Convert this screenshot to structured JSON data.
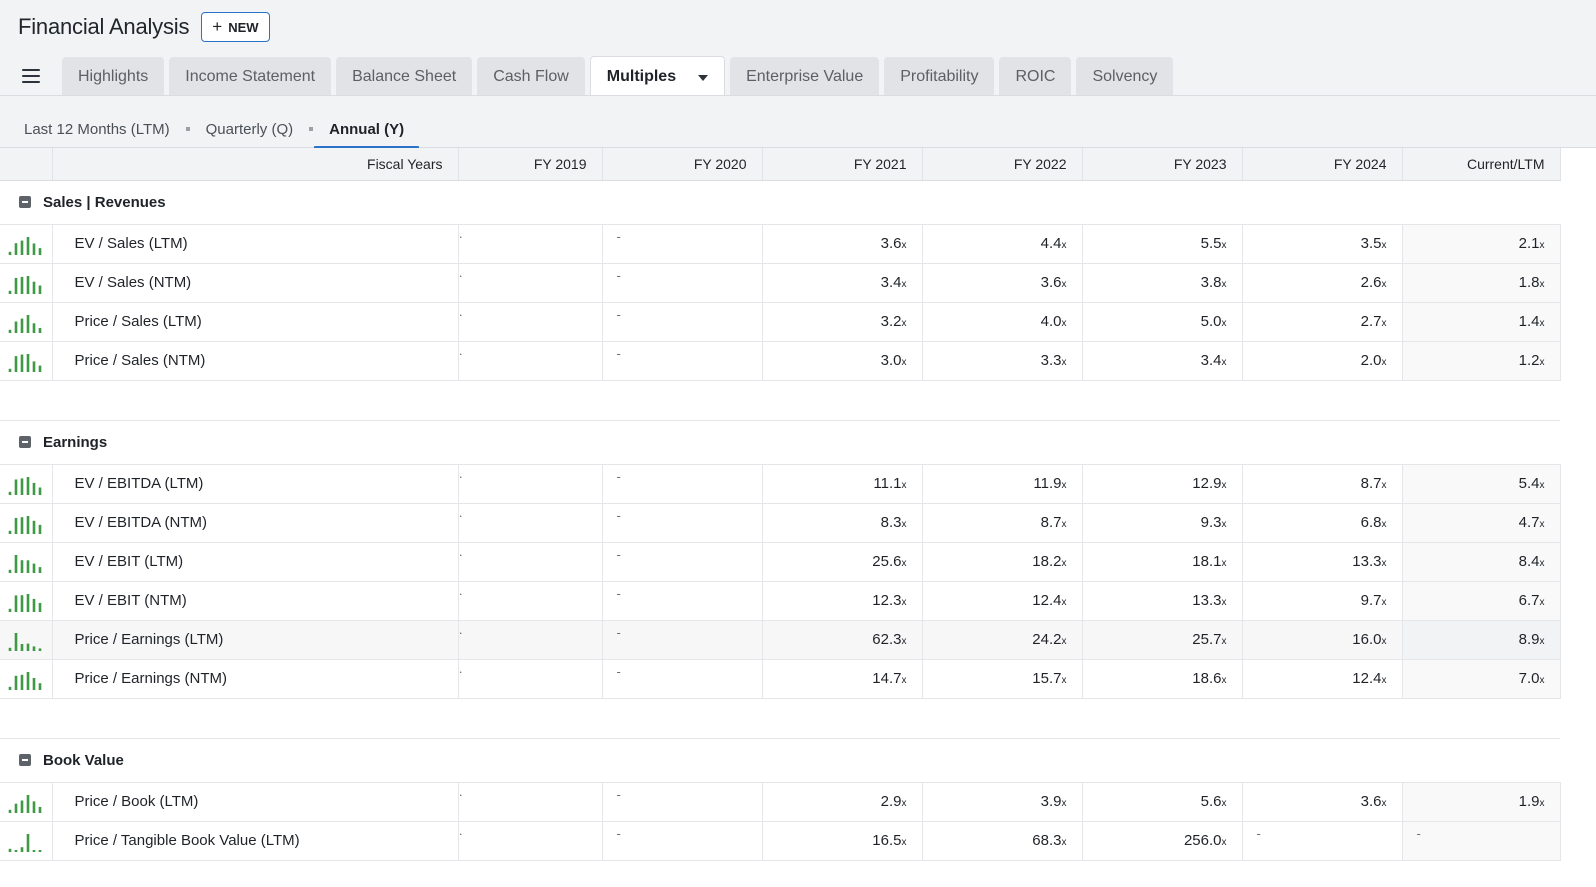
{
  "header": {
    "title": "Financial Analysis",
    "new_label": "NEW"
  },
  "tabs": [
    {
      "label": "Highlights",
      "active": false
    },
    {
      "label": "Income Statement",
      "active": false
    },
    {
      "label": "Balance Sheet",
      "active": false
    },
    {
      "label": "Cash Flow",
      "active": false
    },
    {
      "label": "Multiples",
      "active": true
    },
    {
      "label": "Enterprise Value",
      "active": false
    },
    {
      "label": "Profitability",
      "active": false
    },
    {
      "label": "ROIC",
      "active": false
    },
    {
      "label": "Solvency",
      "active": false
    }
  ],
  "periods": [
    {
      "label": "Last 12 Months (LTM)",
      "active": false
    },
    {
      "label": "Quarterly (Q)",
      "active": false
    },
    {
      "label": "Annual (Y)",
      "active": true
    }
  ],
  "table": {
    "columns": [
      "Fiscal Years",
      "FY 2019",
      "FY 2020",
      "FY 2021",
      "FY 2022",
      "FY 2023",
      "FY 2024",
      "Current/LTM"
    ],
    "empty_marker": "-",
    "unit_suffix": "x",
    "sections": [
      {
        "title": "Sales | Revenues",
        "rows": [
          {
            "label": "EV / Sales (LTM)",
            "values": [
              "3.6",
              "4.4",
              "5.5",
              "3.5",
              "2.1"
            ]
          },
          {
            "label": "EV / Sales (NTM)",
            "values": [
              "3.4",
              "3.6",
              "3.8",
              "2.6",
              "1.8"
            ]
          },
          {
            "label": "Price / Sales (LTM)",
            "values": [
              "3.2",
              "4.0",
              "5.0",
              "2.7",
              "1.4"
            ]
          },
          {
            "label": "Price / Sales (NTM)",
            "values": [
              "3.0",
              "3.3",
              "3.4",
              "2.0",
              "1.2"
            ]
          }
        ]
      },
      {
        "title": "Earnings",
        "rows": [
          {
            "label": "EV / EBITDA (LTM)",
            "values": [
              "11.1",
              "11.9",
              "12.9",
              "8.7",
              "5.4"
            ]
          },
          {
            "label": "EV / EBITDA (NTM)",
            "values": [
              "8.3",
              "8.7",
              "9.3",
              "6.8",
              "4.7"
            ]
          },
          {
            "label": "EV / EBIT (LTM)",
            "values": [
              "25.6",
              "18.2",
              "18.1",
              "13.3",
              "8.4"
            ]
          },
          {
            "label": "EV / EBIT (NTM)",
            "values": [
              "12.3",
              "12.4",
              "13.3",
              "9.7",
              "6.7"
            ]
          },
          {
            "label": "Price / Earnings (LTM)",
            "values": [
              "62.3",
              "24.2",
              "25.7",
              "16.0",
              "8.9"
            ],
            "highlight": true
          },
          {
            "label": "Price / Earnings (NTM)",
            "values": [
              "14.7",
              "15.7",
              "18.6",
              "12.4",
              "7.0"
            ]
          }
        ]
      },
      {
        "title": "Book Value",
        "rows": [
          {
            "label": "Price / Book (LTM)",
            "values": [
              "2.9",
              "3.9",
              "5.6",
              "3.6",
              "1.9"
            ]
          },
          {
            "label": "Price / Tangible Book Value (LTM)",
            "values": [
              "16.5",
              "68.3",
              "256.0",
              null,
              null
            ]
          }
        ]
      }
    ]
  },
  "colors": {
    "accent": "#2a73c9",
    "spark_bar": "#3f9a45",
    "tab_bg": "#e1e3e7",
    "header_bg": "#f2f3f5"
  },
  "icons": {
    "menu": "hamburger-icon",
    "new": "plus-icon",
    "collapse": "collapse-minus-icon",
    "tab_dropdown": "chevron-down-icon",
    "row_chart": "bar-chart-icon"
  }
}
